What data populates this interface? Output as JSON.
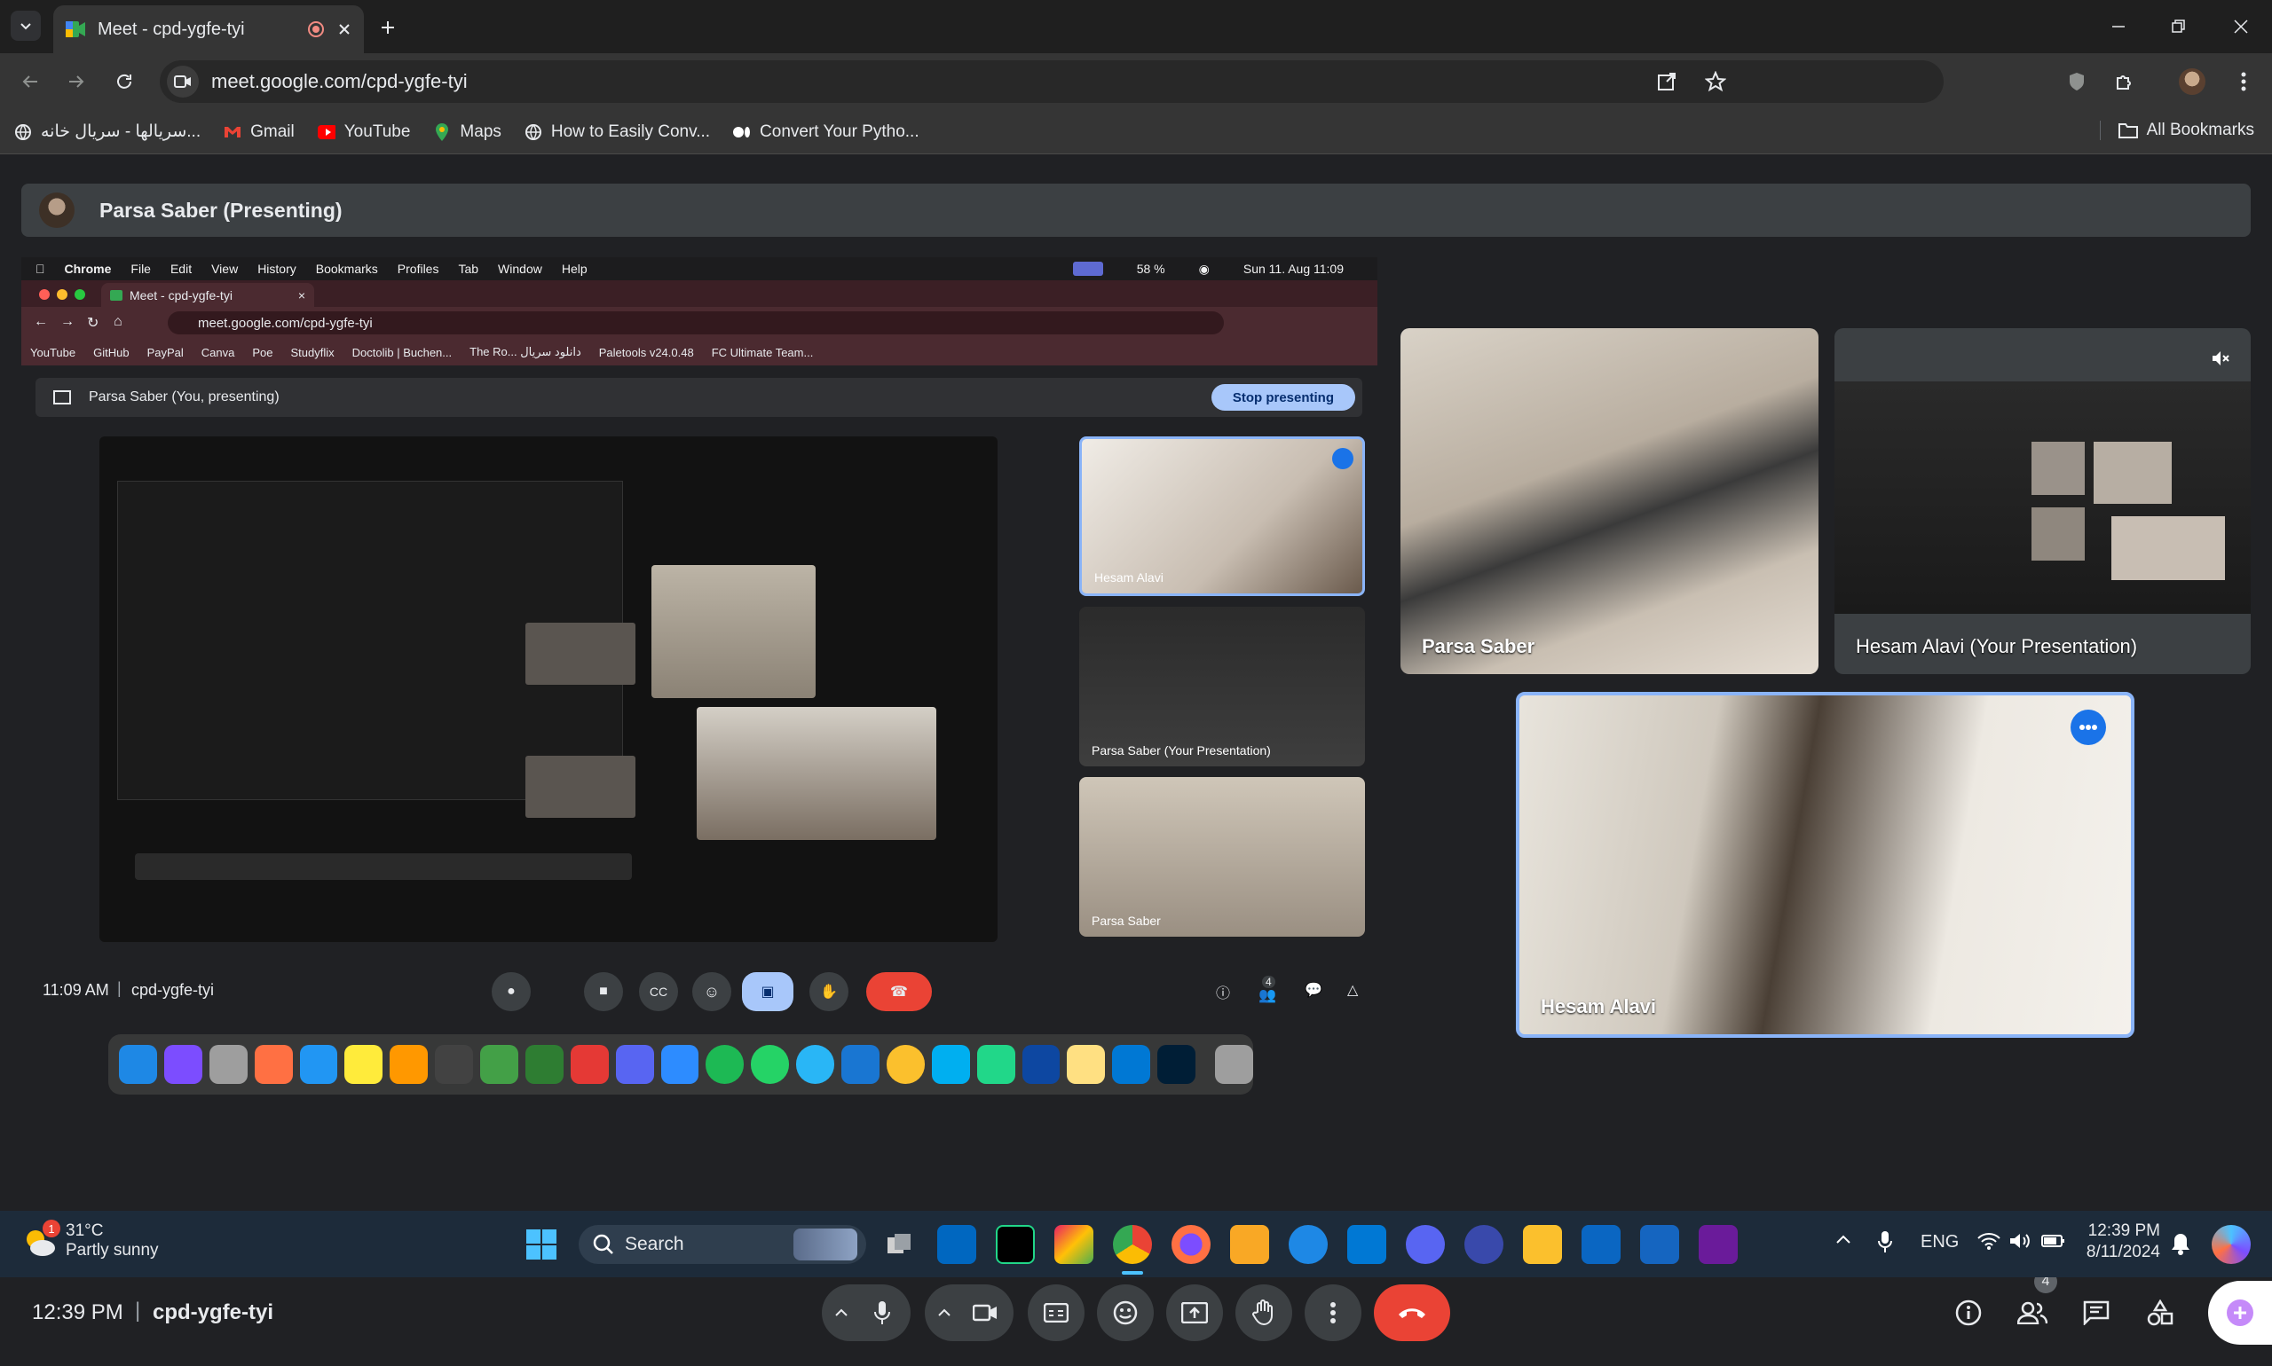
{
  "browser": {
    "tab_title": "Meet - cpd-ygfe-tyi",
    "url": "meet.google.com/cpd-ygfe-tyi",
    "bookmarks": [
      {
        "label": "سریالها - سریال خانه...",
        "icon": "globe-icon"
      },
      {
        "label": "Gmail",
        "icon": "gmail-icon"
      },
      {
        "label": "YouTube",
        "icon": "youtube-icon"
      },
      {
        "label": "Maps",
        "icon": "maps-icon"
      },
      {
        "label": "How to Easily Conv...",
        "icon": "globe-icon"
      },
      {
        "label": "Convert Your Pytho...",
        "icon": "medium-icon"
      }
    ],
    "all_bookmarks": "All Bookmarks"
  },
  "meet": {
    "presenting_label": "Parsa Saber (Presenting)",
    "time": "12:39 PM",
    "meeting_code": "cpd-ygfe-tyi",
    "people_count": "4",
    "tiles": {
      "parsa": "Parsa Saber",
      "hesam_presentation": "Hesam Alavi (Your Presentation)",
      "hesam": "Hesam Alavi"
    }
  },
  "shared_screen": {
    "menubar": [
      "Chrome",
      "File",
      "Edit",
      "View",
      "History",
      "Bookmarks",
      "Profiles",
      "Tab",
      "Window",
      "Help"
    ],
    "battery": "58 %",
    "clock": "Sun 11. Aug 11:09",
    "tab_title": "Meet - cpd-ygfe-tyi",
    "url": "meet.google.com/cpd-ygfe-tyi",
    "bookmarks": [
      "YouTube",
      "GitHub",
      "PayPal",
      "Canva",
      "Poe",
      "Studyflix",
      "Doctolib | Buchen...",
      "The Ro... دانلود سریال",
      "Paletools v24.0.48",
      "FC Ultimate Team..."
    ],
    "presenting_label": "Parsa Saber (You, presenting)",
    "stop_presenting": "Stop presenting",
    "tile_hesam": "Hesam Alavi",
    "tile_parsa_presentation": "Parsa Saber (Your Presentation)",
    "tile_parsa": "Parsa Saber",
    "time": "11:09 AM",
    "meeting_code": "cpd-ygfe-tyi",
    "people_count": "4"
  },
  "taskbar": {
    "weather_temp": "31°C",
    "weather_desc": "Partly sunny",
    "weather_badge": "1",
    "search_label": "Search",
    "language": "ENG",
    "time": "12:39 PM",
    "date": "8/11/2024"
  },
  "colors": {
    "meet_bg": "#202124",
    "end_call": "#ea4335",
    "accent_blue": "#8ab4f8",
    "taskbar": "#1d2b3a"
  }
}
